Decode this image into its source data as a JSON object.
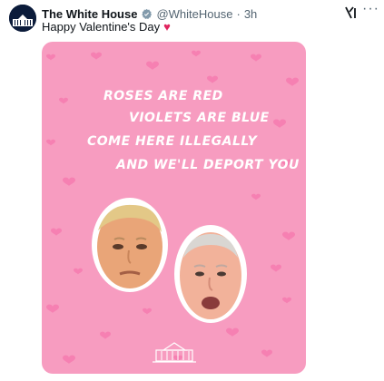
{
  "post": {
    "author_name": "The White House",
    "handle": "@WhiteHouse",
    "separator": "·",
    "time": "3h",
    "text": "Happy Valentine's Day",
    "text_emoji": "heart-emoji"
  },
  "icons": {
    "verified": "verified-badge-icon",
    "grok": "grok-icon",
    "more": "more-options-icon"
  },
  "image": {
    "poem_lines": [
      "ROSES ARE RED",
      "VIOLETS ARE BLUE",
      "COME HERE ILLEGALLY",
      "AND WE'LL DEPORT YOU"
    ],
    "colors": {
      "background": "#f79cc0",
      "heart": "#f56aa6",
      "text": "#ffffff"
    }
  }
}
